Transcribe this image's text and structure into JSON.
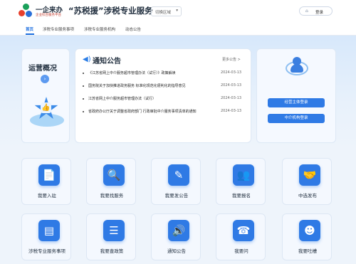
{
  "header": {
    "brand": "一企来办",
    "brand_sub": "企业综合服务平台",
    "title": "“苏税援”涉税专业服务",
    "region": "切换区域",
    "login": "登录"
  },
  "nav": {
    "tabs": [
      {
        "label": "首页"
      },
      {
        "label": "涉税专业服务事项"
      },
      {
        "label": "涉税专业服务机构"
      },
      {
        "label": "动态公告"
      }
    ]
  },
  "overview": {
    "title": "运营概况",
    "arrow": "›"
  },
  "notice": {
    "title": "通知公告",
    "more": "更多公告 >",
    "items": [
      {
        "text": "《江苏省网上中介服务超市管理办法（试行）》政策解读",
        "date": "2024-03-13"
      },
      {
        "text": "国务院关于加快推进政务服务 标准化规范化便利化的指导意见",
        "date": "2024-03-13"
      },
      {
        "text": "江苏省网上中介服务超市管理办法（试行）",
        "date": "2024-03-13"
      },
      {
        "text": "省政府办公厅关于调整省政府部门 行政审批中介服务事项清单的通知",
        "date": "2024-03-13"
      }
    ]
  },
  "login_card": {
    "btn_entity": "经营主体登录",
    "btn_agency": "中介机构登录"
  },
  "tiles": [
    {
      "label": "我要入驻",
      "icon": "📄"
    },
    {
      "label": "我要找服务",
      "icon": "🔍"
    },
    {
      "label": "我要发公告",
      "icon": "✎"
    },
    {
      "label": "我要报名",
      "icon": "👥"
    },
    {
      "label": "中选发布",
      "icon": "🤝"
    },
    {
      "label": "涉税专业服务事项",
      "icon": "▤"
    },
    {
      "label": "我要查政策",
      "icon": "☰"
    },
    {
      "label": "通知公告",
      "icon": "🔊"
    },
    {
      "label": "我要问",
      "icon": "☎"
    },
    {
      "label": "我要吐槽",
      "icon": "☻"
    }
  ]
}
